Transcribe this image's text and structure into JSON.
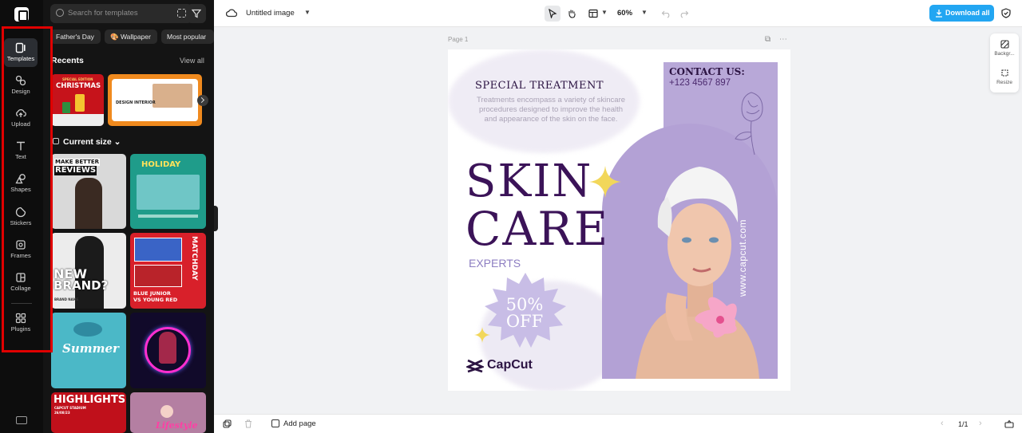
{
  "left_rail": {
    "items": [
      {
        "label": "Templates",
        "icon": "templates-icon",
        "active": true
      },
      {
        "label": "Design",
        "icon": "design-icon"
      },
      {
        "label": "Upload",
        "icon": "upload-icon"
      },
      {
        "label": "Text",
        "icon": "text-icon"
      },
      {
        "label": "Shapes",
        "icon": "shapes-icon"
      },
      {
        "label": "Stickers",
        "icon": "stickers-icon"
      },
      {
        "label": "Frames",
        "icon": "frames-icon"
      },
      {
        "label": "Collage",
        "icon": "collage-icon"
      },
      {
        "label": "Plugins",
        "icon": "plugins-icon"
      }
    ],
    "highlight_color": "#e00000"
  },
  "panel": {
    "search_placeholder": "Search for templates",
    "chips": [
      "Father's Day",
      "🎨 Wallpaper",
      "Most popular"
    ],
    "recents_title": "Recents",
    "view_all": "View all",
    "current_size": "Current size",
    "recents": [
      {
        "name": "christmas-template",
        "text1": "SPECIAL EDITION",
        "text2": "CHRISTMAS"
      },
      {
        "name": "design-interior-template",
        "text1": "DESIGN INTERIOR"
      }
    ],
    "templates": [
      {
        "name": "make-better-reviews",
        "text1": "MAKE BETTER",
        "text2": "REVIEWS"
      },
      {
        "name": "holiday",
        "text1": "HOLIDAY"
      },
      {
        "name": "new-brand",
        "text1": "NEW",
        "text2": "BRAND?",
        "text3": "BRAND NAME"
      },
      {
        "name": "matchday",
        "text1": "MATCHDAY",
        "text2": "BLUE JUNIOR",
        "text3": "VS YOUNG RED"
      },
      {
        "name": "summer",
        "text1": "Summer"
      },
      {
        "name": "neon-portrait"
      },
      {
        "name": "highlights",
        "text1": "HIGHLIGHTS",
        "text2": "CAPCUT STADIUM",
        "text3": "26/08/23"
      },
      {
        "name": "lifestyle",
        "text1": "Lifestyle"
      }
    ]
  },
  "topbar": {
    "title": "Untitled image",
    "zoom": "60%",
    "download": "Download all"
  },
  "canvas": {
    "page_label": "Page 1",
    "design": {
      "heading": "SPECIAL TREATMENT",
      "description": "Treatments encompass a variety of skincare procedures designed to improve the health and appearance of the skin on the face.",
      "title_line1": "SKIN",
      "title_line2": "CARE",
      "subtitle": "EXPERTS",
      "offer_line1": "50%",
      "offer_line2": "OFF",
      "contact_title": "CONTACT US:",
      "contact_phone": "+123 4567 897",
      "website": "www.capcut.com",
      "brand": "CapCut",
      "colors": {
        "purple": "#b8a8d8",
        "dark": "#3b1358",
        "accent": "#8d7ec2",
        "star": "#f2d75a"
      }
    }
  },
  "right_panel": {
    "items": [
      {
        "label": "Backgr..."
      },
      {
        "label": "Resize"
      }
    ]
  },
  "bottombar": {
    "add_page": "Add page",
    "page_count": "1/1"
  }
}
